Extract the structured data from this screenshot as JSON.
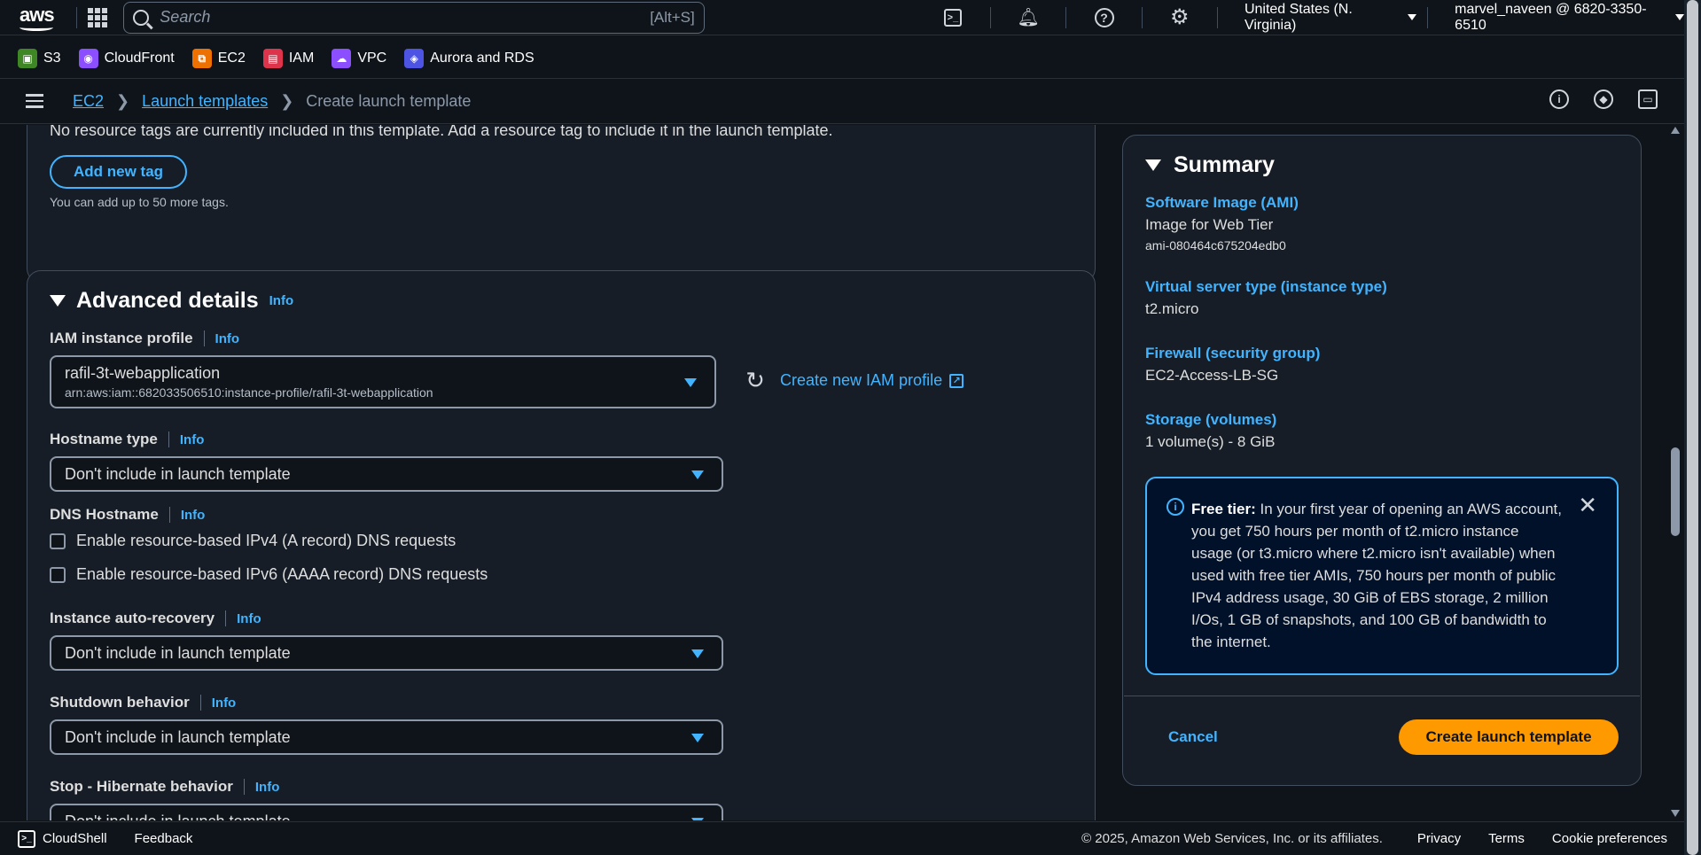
{
  "topbar": {
    "logo": "aws",
    "search_placeholder": "Search",
    "search_hint": "[Alt+S]",
    "region": "United States (N. Virginia)",
    "account": "marvel_naveen @ 6820-3350-6510"
  },
  "favorites": [
    {
      "label": "S3",
      "color": "#3f8624"
    },
    {
      "label": "CloudFront",
      "color": "#8c4fff"
    },
    {
      "label": "EC2",
      "color": "#ed7100"
    },
    {
      "label": "IAM",
      "color": "#dd344c"
    },
    {
      "label": "VPC",
      "color": "#8c4fff"
    },
    {
      "label": "Aurora and RDS",
      "color": "#4d54e3"
    }
  ],
  "breadcrumb": {
    "ec2": "EC2",
    "launch_templates": "Launch templates",
    "current": "Create launch template"
  },
  "tags": {
    "empty_text": "No resource tags are currently included in this template. Add a resource tag to include it in the launch template.",
    "add_button": "Add new tag",
    "note": "You can add up to 50 more tags."
  },
  "advanced": {
    "title": "Advanced details",
    "info": "Info",
    "iam_label": "IAM instance profile",
    "iam_value": "rafil-3t-webapplication",
    "iam_arn": "arn:aws:iam::682033506510:instance-profile/rafil-3t-webapplication",
    "create_iam": "Create new IAM profile",
    "hostname_label": "Hostname type",
    "hostname_value": "Don't include in launch template",
    "dns_label": "DNS Hostname",
    "dns_ipv4": "Enable resource-based IPv4 (A record) DNS requests",
    "dns_ipv6": "Enable resource-based IPv6 (AAAA record) DNS requests",
    "recovery_label": "Instance auto-recovery",
    "recovery_value": "Don't include in launch template",
    "shutdown_label": "Shutdown behavior",
    "shutdown_value": "Don't include in launch template",
    "hibernate_label": "Stop - Hibernate behavior",
    "hibernate_value": "Don't include in launch template"
  },
  "summary": {
    "title": "Summary",
    "ami_key": "Software Image (AMI)",
    "ami_name": "Image for Web Tier",
    "ami_id": "ami-080464c675204edb0",
    "type_key": "Virtual server type (instance type)",
    "type_value": "t2.micro",
    "fw_key": "Firewall (security group)",
    "fw_value": "EC2-Access-LB-SG",
    "storage_key": "Storage (volumes)",
    "storage_value": "1 volume(s) - 8 GiB",
    "free_tier_label": "Free tier:",
    "free_tier_text": "In your first year of opening an AWS account, you get 750 hours per month of t2.micro instance usage (or t3.micro where t2.micro isn't available) when used with free tier AMIs, 750 hours per month of public IPv4 address usage, 30 GiB of EBS storage, 2 million I/Os, 1 GB of snapshots, and 100 GB of bandwidth to the internet.",
    "cancel": "Cancel",
    "create": "Create launch template"
  },
  "footer": {
    "cloudshell": "CloudShell",
    "feedback": "Feedback",
    "copyright": "© 2025, Amazon Web Services, Inc. or its affiliates.",
    "privacy": "Privacy",
    "terms": "Terms",
    "cookies": "Cookie preferences"
  }
}
